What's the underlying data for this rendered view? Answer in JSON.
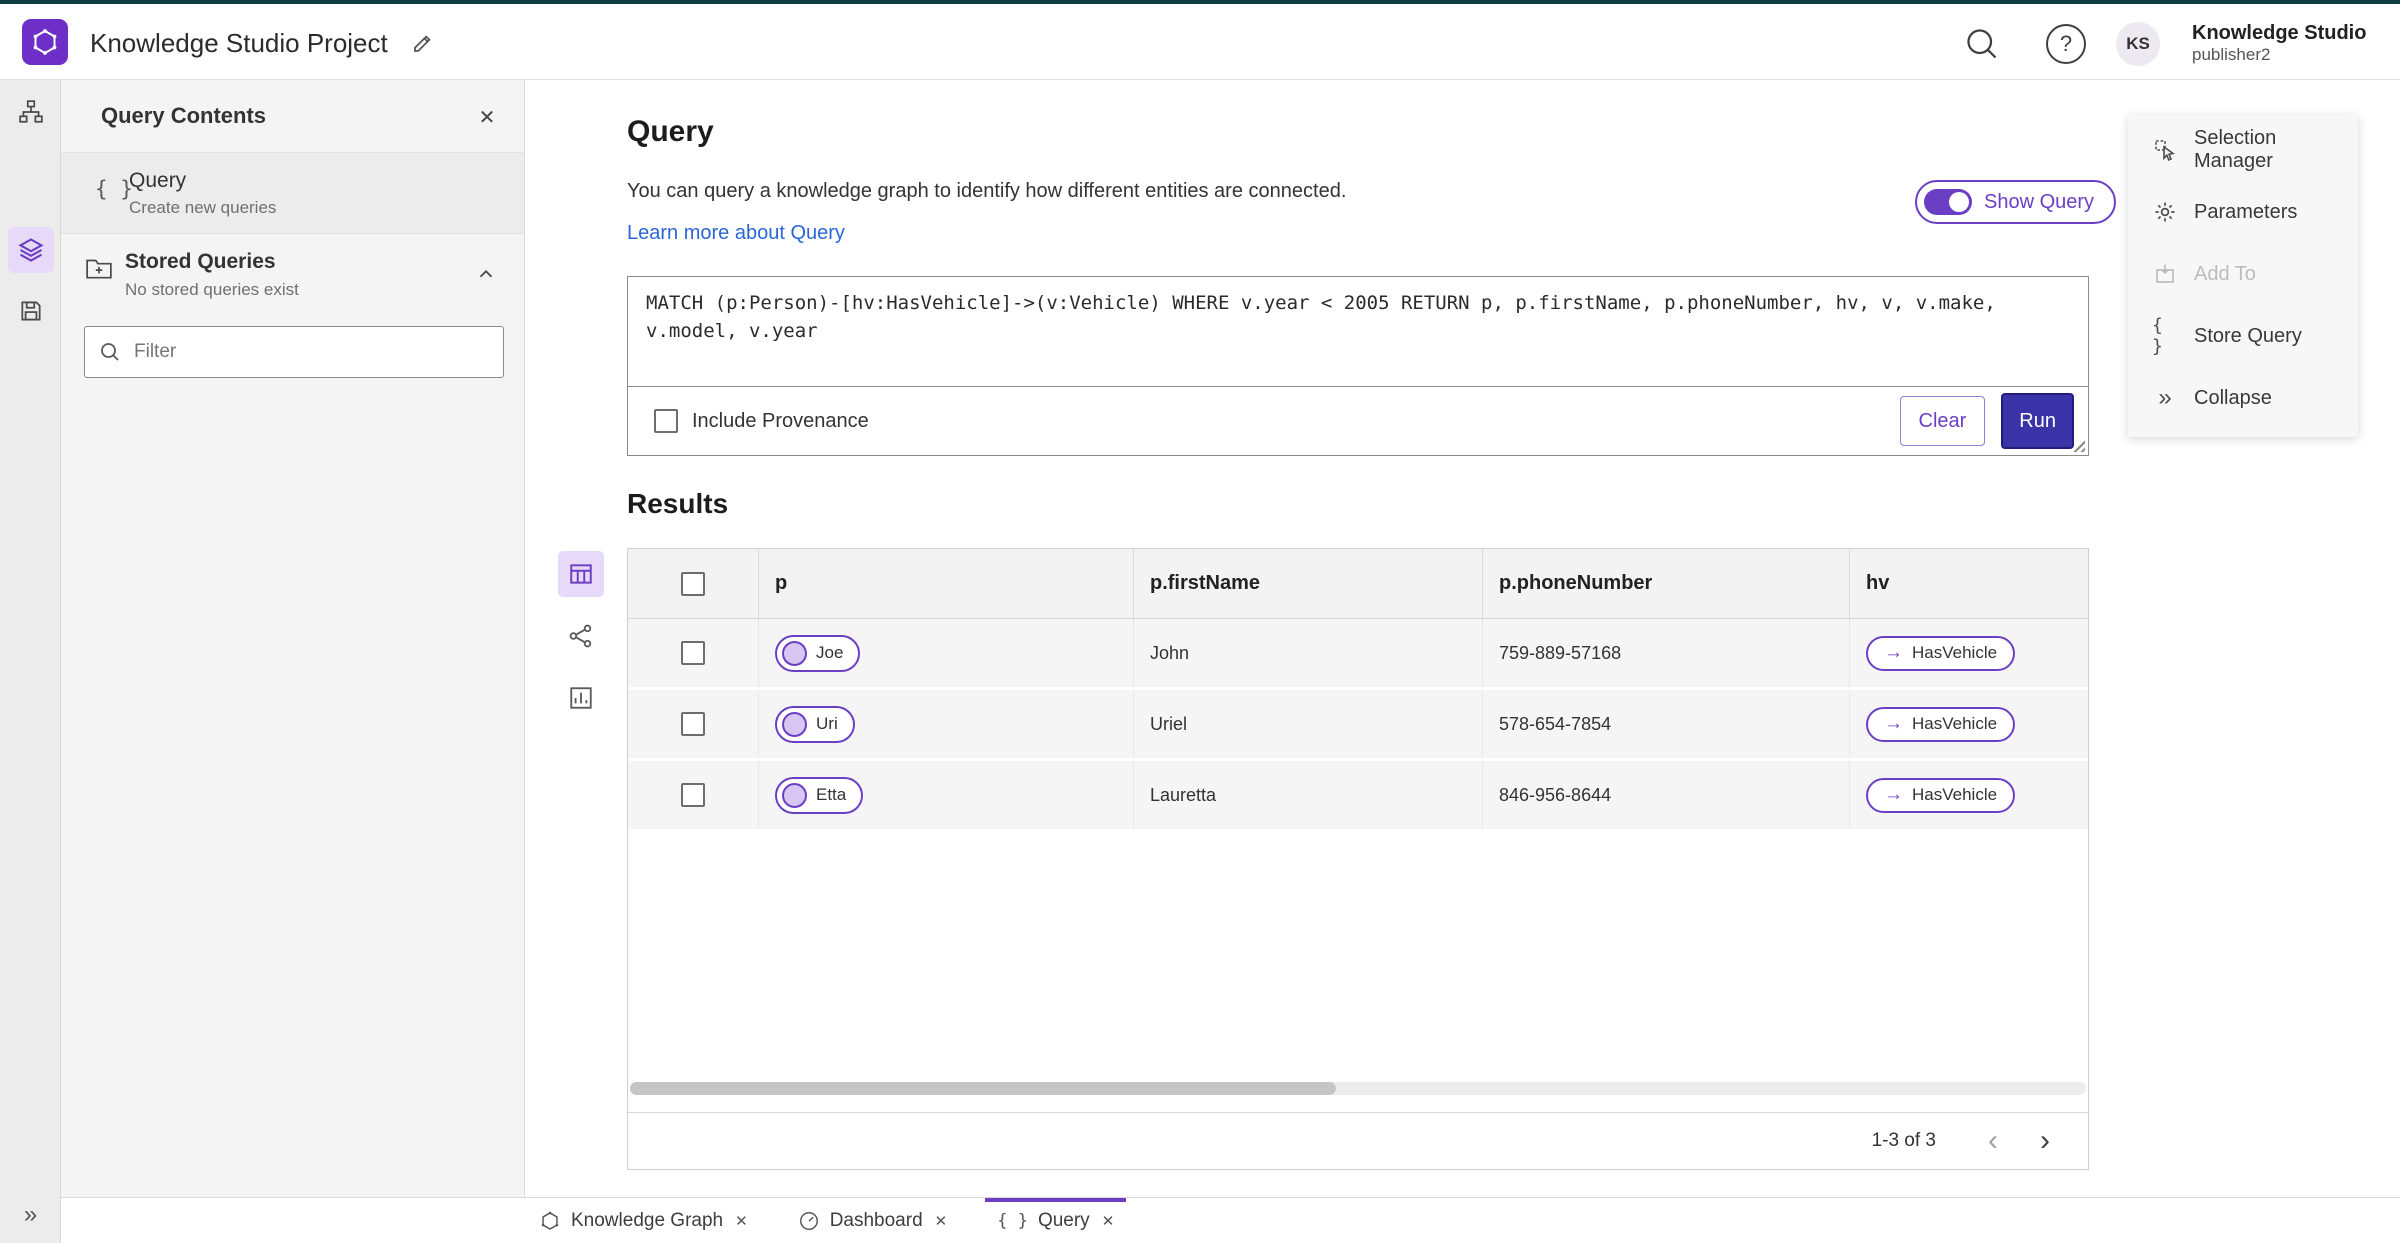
{
  "topbar": {
    "title": "Knowledge Studio Project",
    "user_initials": "KS",
    "user_name": "Knowledge Studio",
    "user_role": "publisher2"
  },
  "left_panel": {
    "title": "Query Contents",
    "query_item_label": "Query",
    "query_item_desc": "Create new queries",
    "stored_label": "Stored Queries",
    "stored_desc": "No stored queries exist",
    "filter_placeholder": "Filter"
  },
  "query_section": {
    "title": "Query",
    "description": "You can query a knowledge graph to identify how different entities are connected.",
    "learn_more": "Learn more about Query",
    "show_query_label": "Show Query",
    "query_text": "MATCH (p:Person)-[hv:HasVehicle]->(v:Vehicle) WHERE v.year < 2005 RETURN p, p.firstName, p.phoneNumber, hv, v, v.make, v.model, v.year",
    "include_provenance": "Include Provenance",
    "clear_label": "Clear",
    "run_label": "Run"
  },
  "results": {
    "title": "Results",
    "columns": [
      "p",
      "p.firstName",
      "p.phoneNumber",
      "hv"
    ],
    "rows": [
      {
        "p": "Joe",
        "firstName": "John",
        "phone": "759-889-57168",
        "hv": "HasVehicle"
      },
      {
        "p": "Uri",
        "firstName": "Uriel",
        "phone": "578-654-7854",
        "hv": "HasVehicle"
      },
      {
        "p": "Etta",
        "firstName": "Lauretta",
        "phone": "846-956-8644",
        "hv": "HasVehicle"
      }
    ],
    "pagination": "1-3 of 3"
  },
  "right_panel": {
    "selection_manager": "Selection Manager",
    "parameters": "Parameters",
    "add_to": "Add To",
    "store_query": "Store Query",
    "collapse": "Collapse"
  },
  "bottom_tabs": {
    "knowledge_graph": "Knowledge Graph",
    "dashboard": "Dashboard",
    "query": "Query"
  },
  "icons": {
    "braces": "{ }",
    "collapse_chevrons": "»",
    "close": "✕",
    "help": "?",
    "arrow_right": "→",
    "chevron_left": "‹",
    "chevron_right": "›"
  },
  "colors": {
    "accent_purple": "#6b3fc4",
    "run_button": "#3a34a8",
    "link_blue": "#2a65d9",
    "top_strip": "#0e3a40"
  }
}
